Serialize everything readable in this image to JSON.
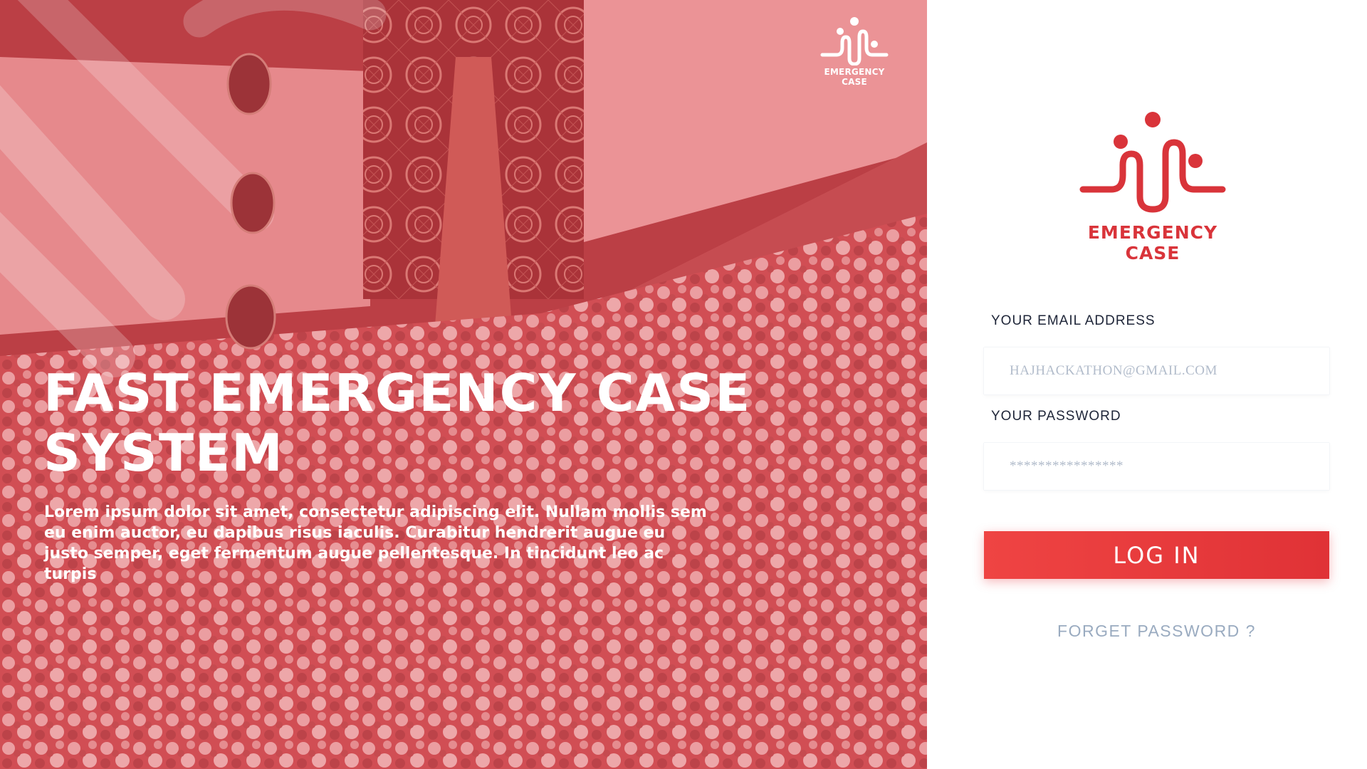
{
  "hero": {
    "logo_text": "EMERGENCY CASE",
    "title": "FAST EMERGENCY CASE SYSTEM",
    "description": "Lorem ipsum dolor sit amet, consectetur adipiscing elit. Nullam mollis sem eu enim auctor, eu dapibus risus iaculis. Curabitur hendrerit augue eu justo semper, eget fermentum augue pellentesque. In tincidunt leo ac turpis"
  },
  "login": {
    "logo_text": "EMERGENCY CASE",
    "email_label": "YOUR EMAIL ADDRESS",
    "email_placeholder": "HAJHACKATHON@GMAIL.COM",
    "password_label": "YOUR PASSWORD",
    "password_placeholder": "****************",
    "submit_label": "LOG IN",
    "forgot_label": "FORGET PASSWORD ?"
  },
  "colors": {
    "brand_red": "#d9343a",
    "button_red": "#ef4443",
    "hero_overlay": "#d9575a",
    "muted_link": "#9aabc0"
  }
}
